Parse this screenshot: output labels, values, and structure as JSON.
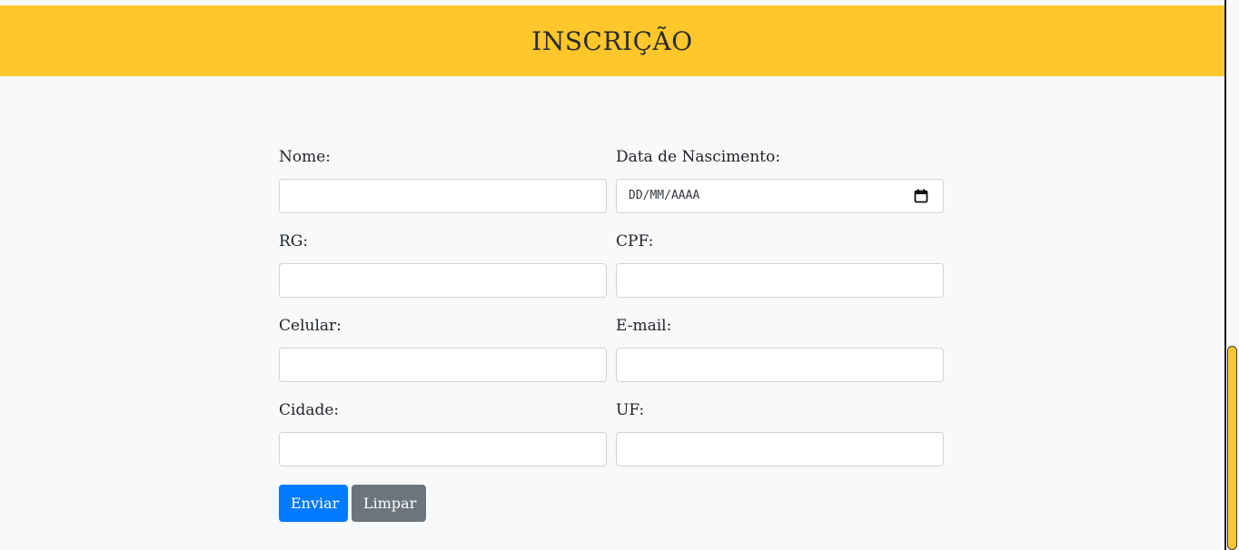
{
  "header": {
    "title": "INSCRIÇÃO"
  },
  "form": {
    "fields": {
      "nome": {
        "label": "Nome:",
        "value": ""
      },
      "nascimento": {
        "label": "Data de Nascimento:",
        "placeholder": "DD/MM/AAAA"
      },
      "rg": {
        "label": "RG:",
        "value": ""
      },
      "cpf": {
        "label": "CPF:",
        "value": ""
      },
      "celular": {
        "label": "Celular:",
        "value": ""
      },
      "email": {
        "label": "E-mail:",
        "value": ""
      },
      "cidade": {
        "label": "Cidade:",
        "value": ""
      },
      "uf": {
        "label": "UF:",
        "value": ""
      }
    },
    "buttons": {
      "submit": "Enviar",
      "reset": "Limpar"
    }
  },
  "icons": {
    "calendar": "calendar-icon"
  },
  "colors": {
    "header_bg": "#ffc72c",
    "primary": "#007bff",
    "secondary": "#6c757d",
    "page_bg": "#f8f9fa"
  }
}
